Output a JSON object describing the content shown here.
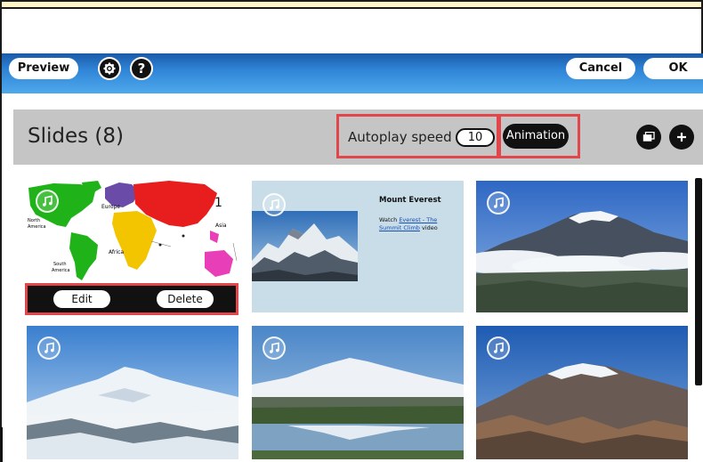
{
  "toolbar": {
    "preview_label": "Preview",
    "settings_icon": "gear-icon",
    "help_label": "?",
    "cancel_label": "Cancel",
    "ok_label": "OK"
  },
  "slides_header": {
    "title": "Slides (8)",
    "autoplay_label": "Autoplay speed",
    "autoplay_value": "10",
    "animation_label": "Animation",
    "copy_icon": "copy-icon",
    "add_icon": "plus-icon"
  },
  "slides": [
    {
      "index": "1",
      "map_labels": {
        "europe": "Europe",
        "asia": "Asia",
        "north_america_1": "North",
        "north_america_2": "America",
        "africa": "Africa",
        "south_america_1": "South",
        "south_america_2": "America"
      },
      "edit_label": "Edit",
      "delete_label": "Delete"
    },
    {
      "heading": "Mount Everest",
      "watch_text": "Watch",
      "link_text": "Everest - The Summit Climb",
      "suffix_text": "video"
    }
  ],
  "colors": {
    "accent_red": "#e0464a",
    "toolbar_blue": "#2f84d6",
    "header_gray": "#c5c5c5"
  }
}
